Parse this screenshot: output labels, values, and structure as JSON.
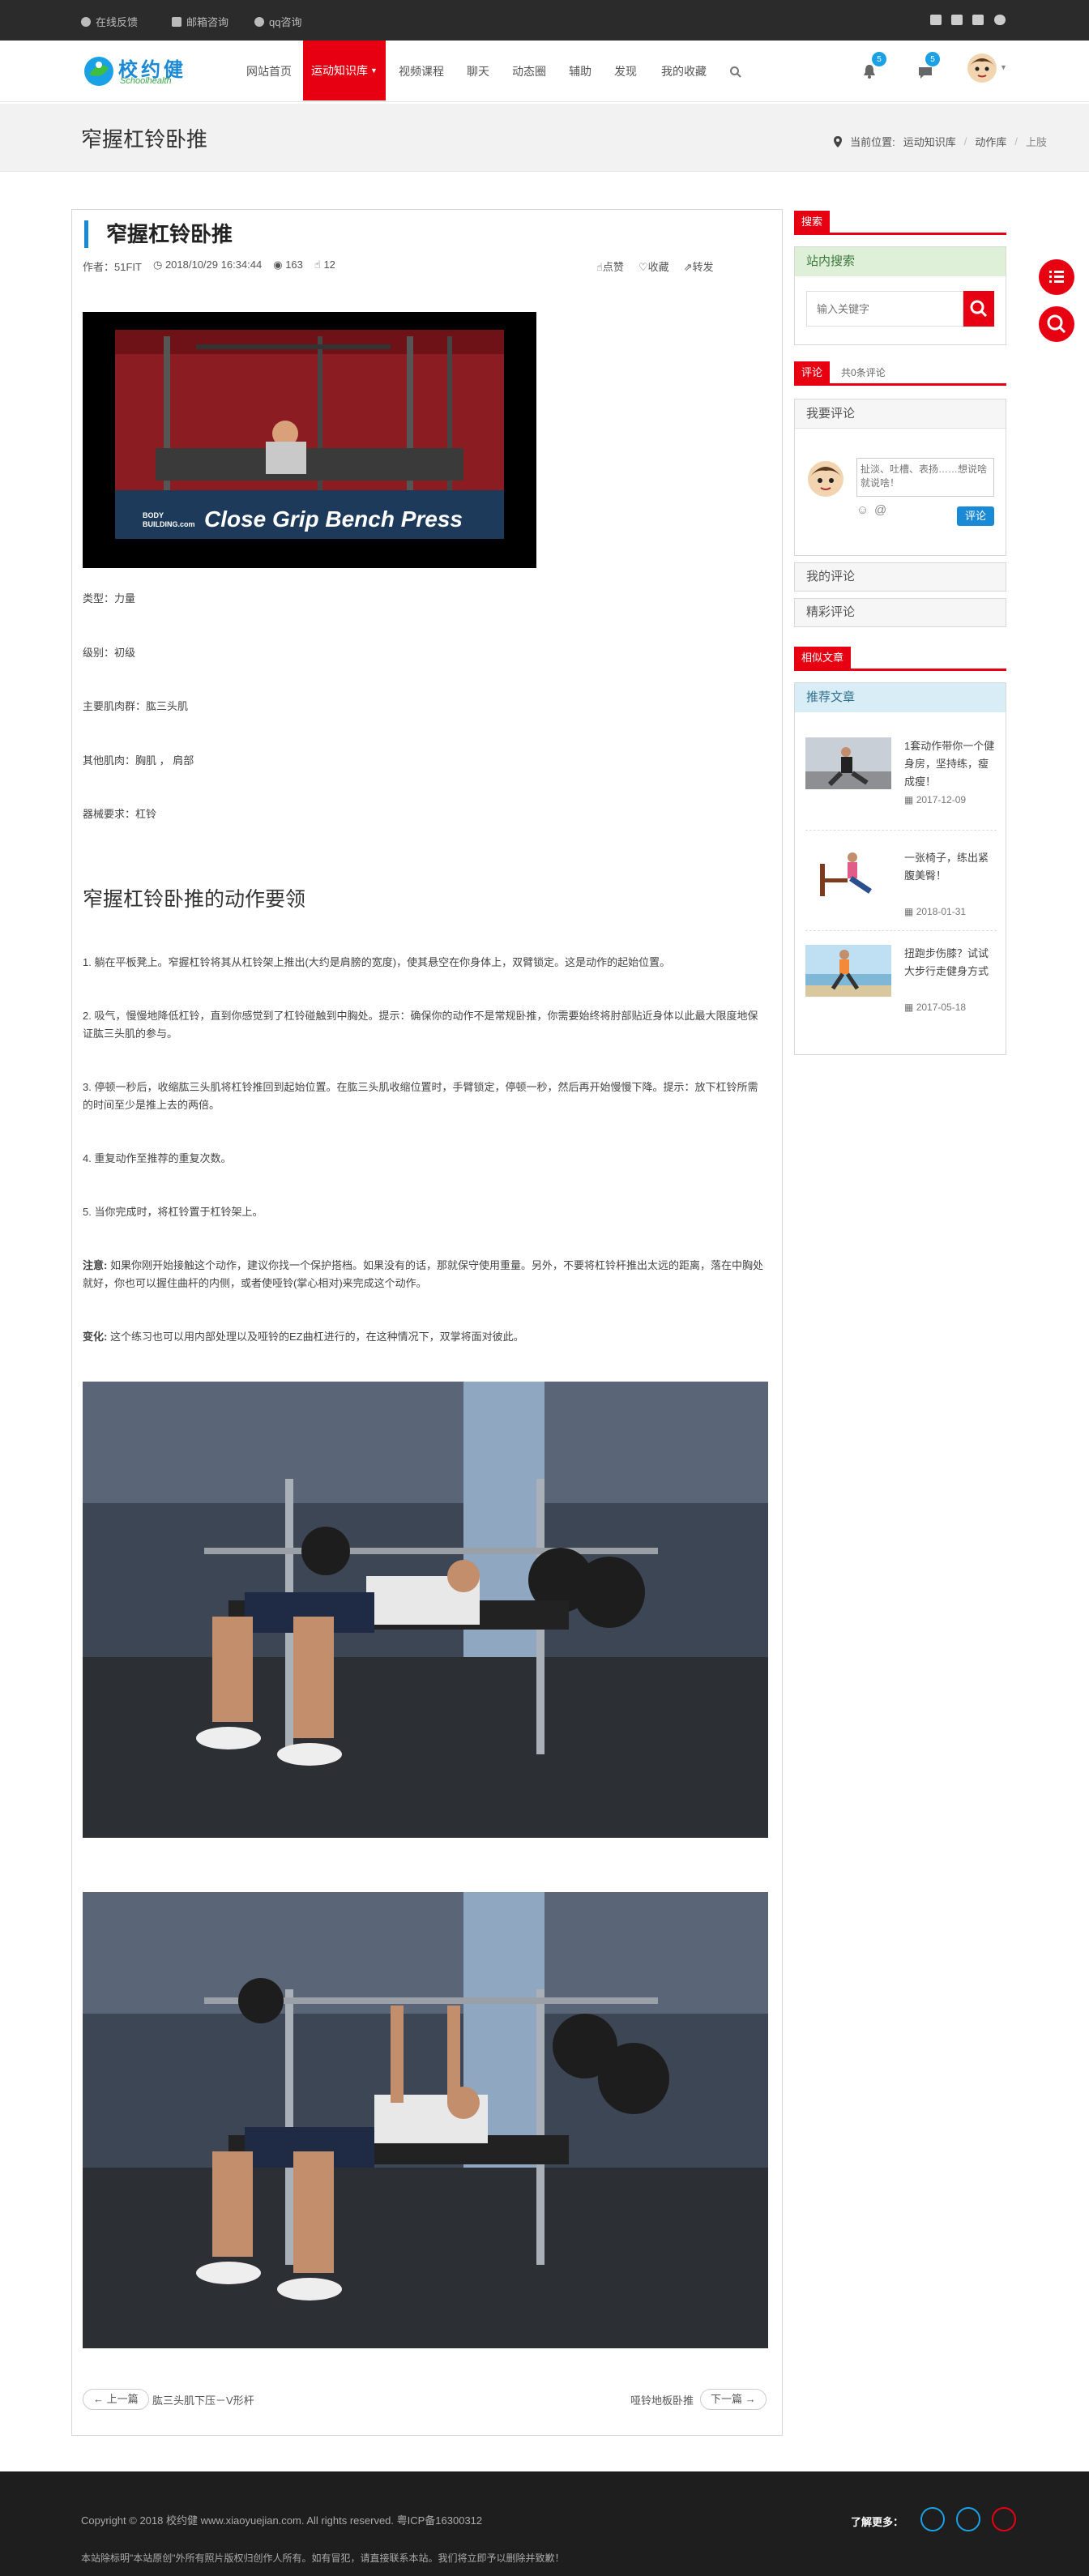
{
  "topbar": {
    "links": [
      "在线反馈",
      "邮箱咨询",
      "qq咨询"
    ]
  },
  "nav": {
    "items": [
      "网站首页",
      "运动知识库",
      "视频课程",
      "聊天",
      "动态圈",
      "辅助",
      "发现",
      "我的收藏"
    ],
    "badge1": "5",
    "badge2": "5",
    "logo_text": "校约健",
    "logo_sub": "Schoolhealth"
  },
  "banner": {
    "title": "窄握杠铃卧推",
    "crumb_label": "当前位置:",
    "crumbs": [
      "运动知识库",
      "动作库",
      "上肢"
    ]
  },
  "article": {
    "title": "窄握杠铃卧推",
    "author": "作者：51FIT",
    "date": "2018/10/29 16:34:44",
    "views": "163",
    "likes": "12",
    "actions": [
      "点赞",
      "收藏",
      "转发"
    ],
    "video_caption": "Close Grip Bench Press",
    "video_brand": "BODY BUILDING.com",
    "fields": [
      "类型：力量",
      "级别：初级",
      "主要肌肉群：肱三头肌",
      "其他肌肉：胸肌 ， 肩部",
      "器械要求：杠铃"
    ],
    "subhead": "窄握杠铃卧推的动作要领",
    "steps": [
      "1. 躺在平板凳上。窄握杠铃将其从杠铃架上推出(大约是肩膀的宽度)，使其悬空在你身体上，双臂锁定。这是动作的起始位置。",
      "2. 吸气，慢慢地降低杠铃，直到你感觉到了杠铃碰触到中胸处。提示：确保你的动作不是常规卧推，你需要始终将肘部贴近身体以此最大限度地保证肱三头肌的参与。",
      "3. 停顿一秒后，收缩肱三头肌将杠铃推回到起始位置。在肱三头肌收缩位置时，手臂锁定，停顿一秒，然后再开始慢慢下降。提示：放下杠铃所需的时间至少是推上去的两倍。",
      "4. 重复动作至推荐的重复次数。",
      "5. 当你完成时，将杠铃置于杠铃架上。"
    ],
    "note_label": "注意:",
    "note": "如果你刚开始接触这个动作，建议你找一个保护搭档。如果没有的话，那就保守使用重量。另外，不要将杠铃杆推出太远的距离，落在中胸处就好，你也可以握住曲杆的内侧，或者使哑铃(掌心相对)来完成这个动作。",
    "var_label": "变化:",
    "variation": "这个练习也可以用内部处理以及哑铃的EZ曲杠进行的，在这种情况下，双掌将面对彼此。",
    "prev_label": "← 上一篇",
    "prev_title": "肱三头肌下压－V形杆",
    "next_title": "哑铃地板卧推",
    "next_label": "下一篇 →"
  },
  "sidebar": {
    "search_head": "搜索",
    "search_box_title": "站内搜索",
    "search_placeholder": "输入关键字",
    "comment_tab": "评论",
    "comment_count": "共0条评论",
    "comment_box_title": "我要评论",
    "comment_placeholder": "扯淡、吐槽、表扬……想说啥就说啥！",
    "comment_button": "评论",
    "my_comments": "我的评论",
    "hot_comments": "精彩评论",
    "rec_head": "相似文章",
    "rec_box_title": "推荐文章",
    "recs": [
      {
        "title": "1套动作带你一个健身房，坚持练，瘦成瘦！",
        "date": "2017-12-09"
      },
      {
        "title": "一张椅子，练出紧腹美臀！",
        "date": "2018-01-31"
      },
      {
        "title": "扭跑步伤膝？试试大步行走健身方式",
        "date": "2017-05-18"
      }
    ]
  },
  "footer": {
    "copyright": "Copyright © 2018 校约健 www.xiaoyuejian.com. All rights reserved. 粤ICP备16300312",
    "disclaimer": "本站除标明\"本站原创\"外所有照片版权归创作人所有。如有冒犯，请直接联系本站。我们将立即予以删除并致歉！",
    "more_label": "了解更多："
  },
  "colors": {
    "brand_red": "#e60012",
    "accent_blue": "#1a8ad6",
    "green_head": "#dff0d8",
    "blue_head": "#d9edf7"
  }
}
